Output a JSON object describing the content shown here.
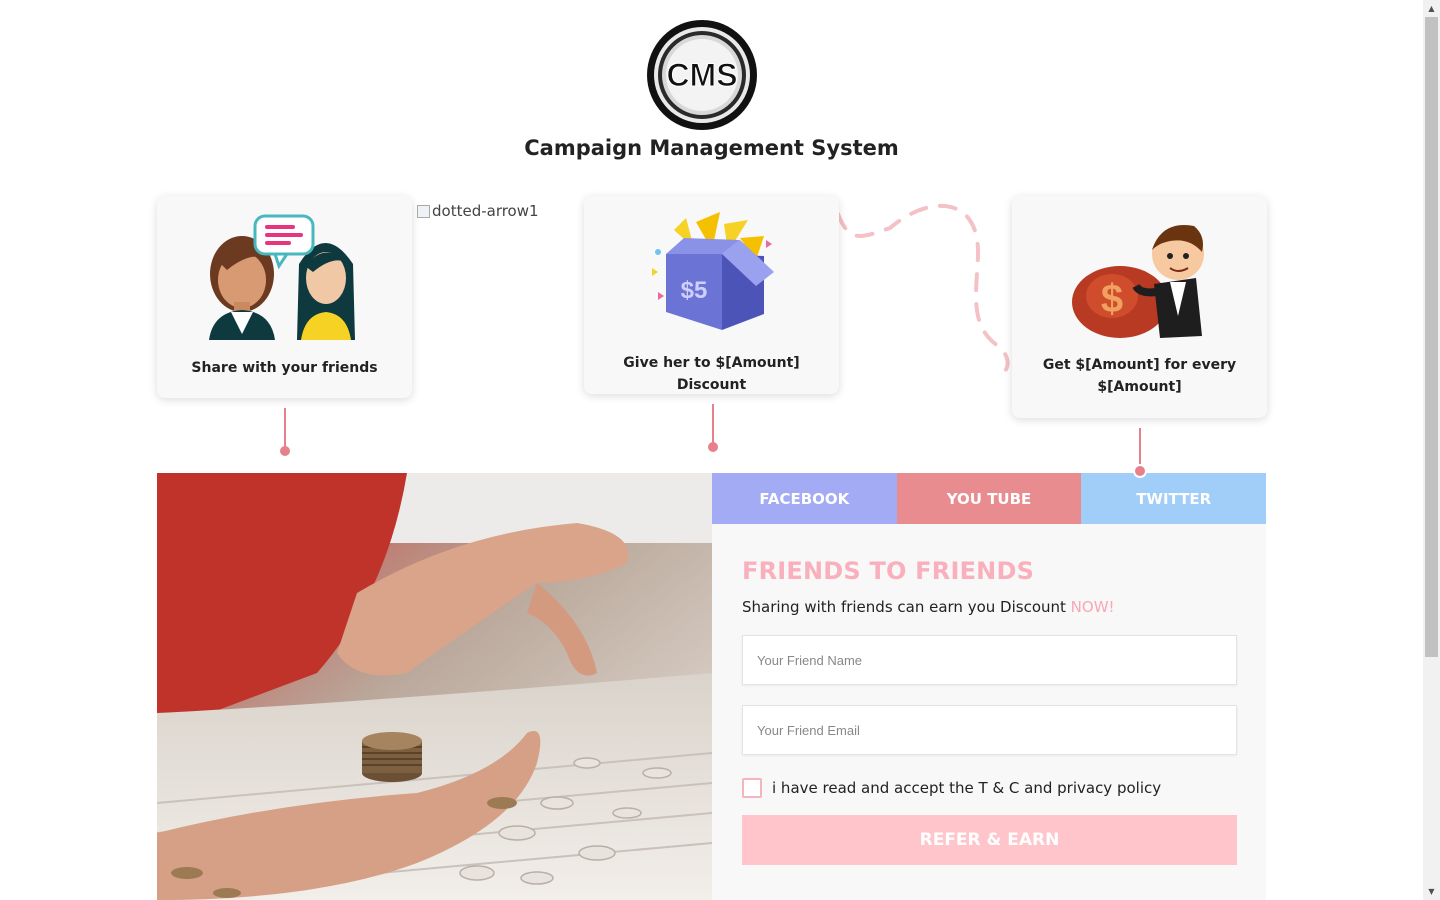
{
  "header": {
    "logo_text": "CMS",
    "title": "Campaign Management System"
  },
  "steps": [
    {
      "label": "Share with your friends",
      "icon": "friends-chat-icon"
    },
    {
      "label": "Give her to $[Amount] Discount",
      "icon": "gift-box-icon",
      "icon_text": "$5"
    },
    {
      "label": "Get $[Amount] for every $[Amount]",
      "icon": "money-bag-man-icon"
    }
  ],
  "broken_image_alt": "dotted-arrow1",
  "tabs": [
    {
      "label": "FACEBOOK",
      "color": "#a2abf3"
    },
    {
      "label": "YOU TUBE",
      "color": "#e98c8f"
    },
    {
      "label": "TWITTER",
      "color": "#a1cdf9"
    }
  ],
  "form": {
    "heading": "FRIENDS TO FRIENDS",
    "subtext": "Sharing with friends can earn you Discount ",
    "subtext_highlight": "NOW!",
    "name_placeholder": "Your Friend Name",
    "email_placeholder": "Your Friend Email",
    "consent_label": "i have read and accept the T & C and privacy policy",
    "consent_checked": false,
    "submit_label": "REFER & EARN"
  },
  "colors": {
    "accent_pink": "#f9b0bc",
    "button_pink": "#ffc5cb",
    "connector": "#e6808a"
  }
}
